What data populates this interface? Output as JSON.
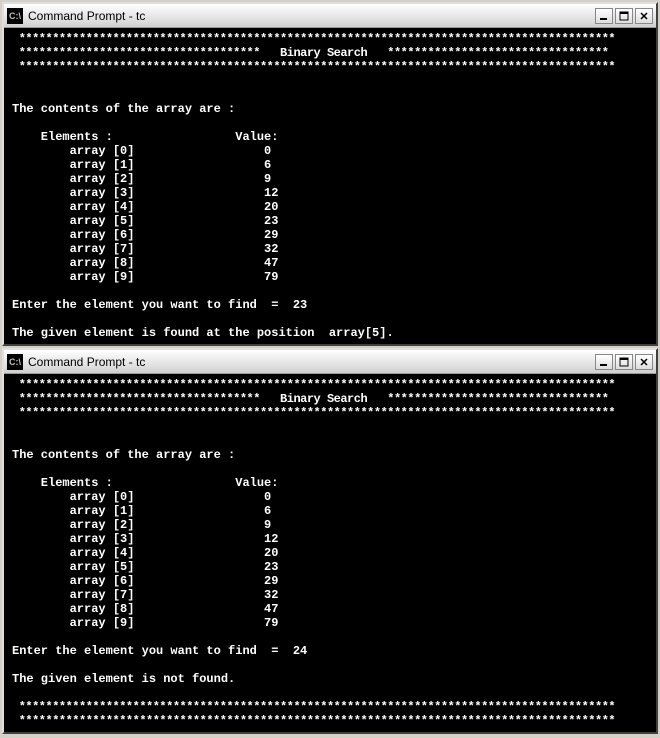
{
  "windows": [
    {
      "title": "Command Prompt - tc",
      "banner_title": "Binary Search",
      "header_line": "The contents of the array are :",
      "col_elements": "Elements :",
      "col_value": "Value:",
      "rows": [
        {
          "label": "array [0]",
          "value": "0"
        },
        {
          "label": "array [1]",
          "value": "6"
        },
        {
          "label": "array [2]",
          "value": "9"
        },
        {
          "label": "array [3]",
          "value": "12"
        },
        {
          "label": "array [4]",
          "value": "20"
        },
        {
          "label": "array [5]",
          "value": "23"
        },
        {
          "label": "array [6]",
          "value": "29"
        },
        {
          "label": "array [7]",
          "value": "32"
        },
        {
          "label": "array [8]",
          "value": "47"
        },
        {
          "label": "array [9]",
          "value": "79"
        }
      ],
      "prompt": "Enter the element you want to find  =  23",
      "result": "The given element is found at the position  array[5]."
    },
    {
      "title": "Command Prompt - tc",
      "banner_title": "Binary Search",
      "header_line": "The contents of the array are :",
      "col_elements": "Elements :",
      "col_value": "Value:",
      "rows": [
        {
          "label": "array [0]",
          "value": "0"
        },
        {
          "label": "array [1]",
          "value": "6"
        },
        {
          "label": "array [2]",
          "value": "9"
        },
        {
          "label": "array [3]",
          "value": "12"
        },
        {
          "label": "array [4]",
          "value": "20"
        },
        {
          "label": "array [5]",
          "value": "23"
        },
        {
          "label": "array [6]",
          "value": "29"
        },
        {
          "label": "array [7]",
          "value": "32"
        },
        {
          "label": "array [8]",
          "value": "47"
        },
        {
          "label": "array [9]",
          "value": "79"
        }
      ],
      "prompt": "Enter the element you want to find  =  24",
      "result": "The given element is not found.",
      "trailing_stars": true
    }
  ]
}
